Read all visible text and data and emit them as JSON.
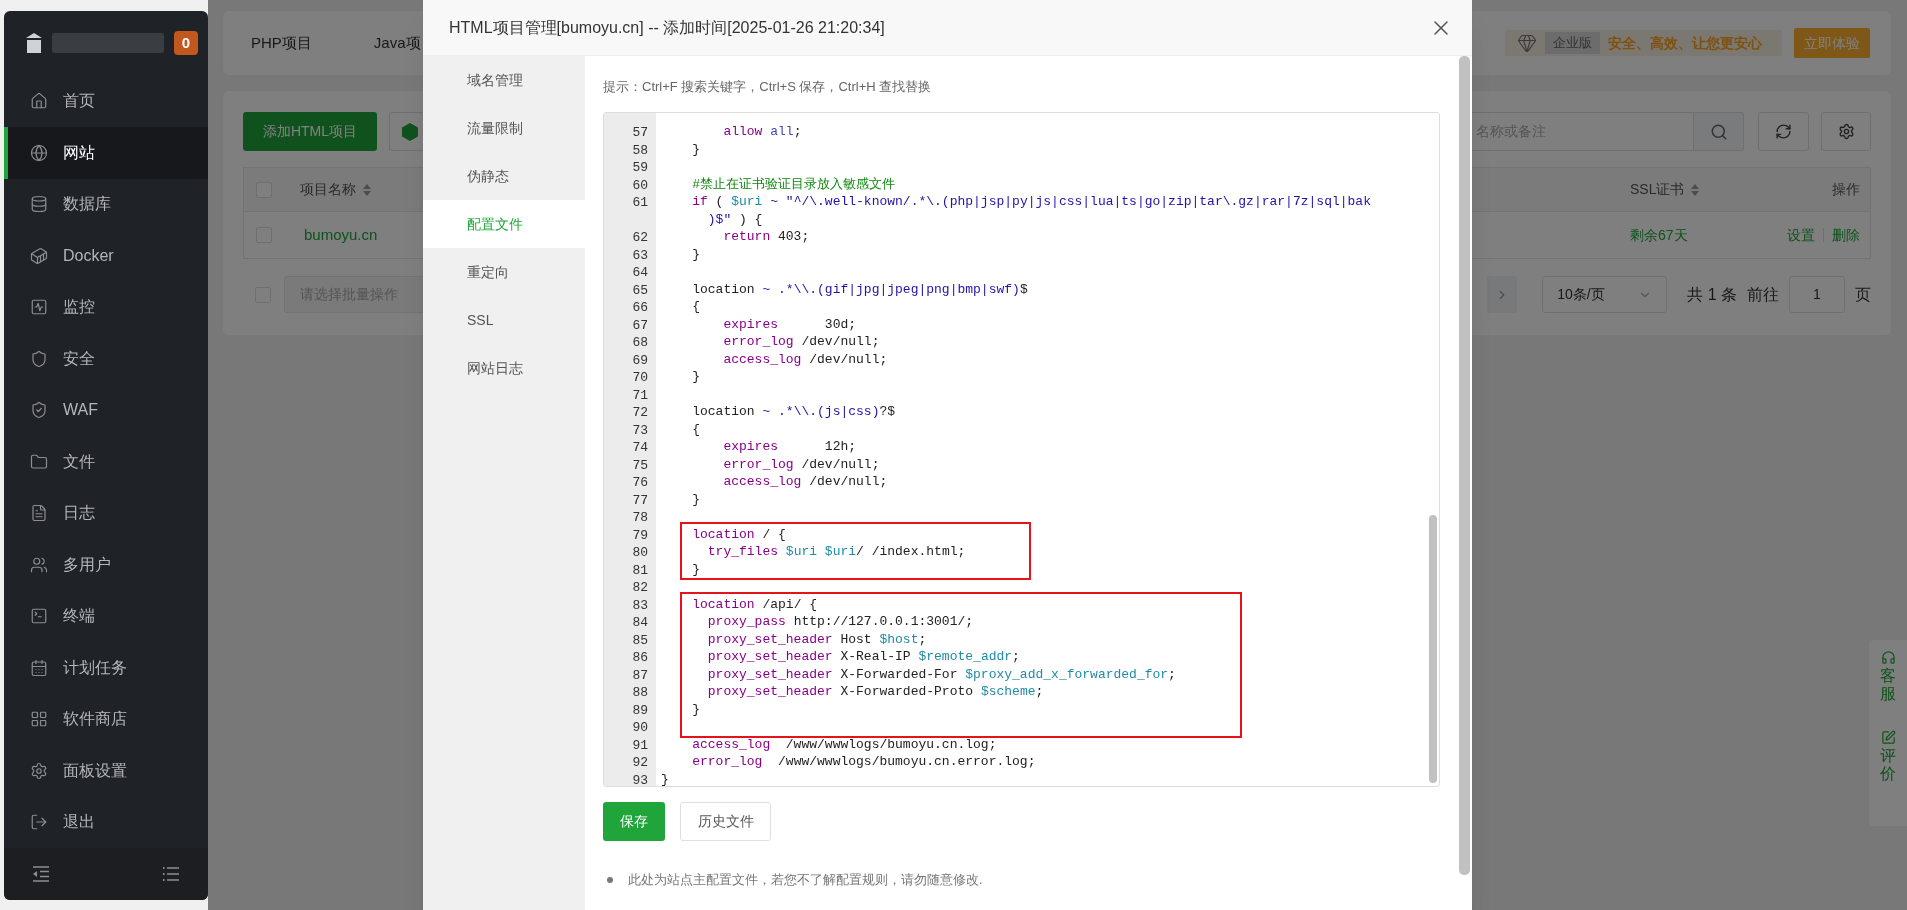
{
  "sidebar": {
    "badge": "0",
    "items": [
      {
        "label": "首页",
        "selected": false
      },
      {
        "label": "网站",
        "selected": true
      },
      {
        "label": "数据库",
        "selected": false
      },
      {
        "label": "Docker",
        "selected": false
      },
      {
        "label": "监控",
        "selected": false
      },
      {
        "label": "安全",
        "selected": false
      },
      {
        "label": "WAF",
        "selected": false
      },
      {
        "label": "文件",
        "selected": false
      },
      {
        "label": "日志",
        "selected": false
      },
      {
        "label": "多用户",
        "selected": false
      },
      {
        "label": "终端",
        "selected": false
      },
      {
        "label": "计划任务",
        "selected": false
      },
      {
        "label": "软件商店",
        "selected": false
      },
      {
        "label": "面板设置",
        "selected": false
      },
      {
        "label": "退出",
        "selected": false
      }
    ]
  },
  "page": {
    "tabs": [
      "PHP项目",
      "Java项"
    ],
    "promo": {
      "edition": "企业版",
      "slogan": "安全、高效、让您更安心",
      "button": "立即体验"
    },
    "toolbar": {
      "add_button": "添加HTML项目",
      "search_placeholder": "名称或备注"
    },
    "table": {
      "header_checked": false,
      "columns": [
        "项目名称",
        "SSL证书",
        "操作"
      ],
      "rows": [
        {
          "checked": false,
          "name": "bumoyu.cn",
          "ssl": "剩余67天",
          "actions": [
            "设置",
            "删除"
          ]
        }
      ]
    },
    "footer": {
      "checked": false,
      "batch_placeholder": "请选择批量操作",
      "page_size": "10条/页",
      "total": "共 1 条",
      "goto": "前往",
      "page": "1",
      "page_suffix": "页"
    },
    "float_panel": [
      "客服",
      "评价"
    ]
  },
  "modal": {
    "title": "HTML项目管理[bumoyu.cn] -- 添加时间[2025-01-26 21:20:34]",
    "nav": [
      {
        "label": "域名管理",
        "selected": false
      },
      {
        "label": "流量限制",
        "selected": false
      },
      {
        "label": "伪静态",
        "selected": false
      },
      {
        "label": "配置文件",
        "selected": true
      },
      {
        "label": "重定向",
        "selected": false
      },
      {
        "label": "SSL",
        "selected": false
      },
      {
        "label": "网站日志",
        "selected": false
      }
    ],
    "hint": "提示：Ctrl+F 搜索关键字，Ctrl+S 保存，Ctrl+H 查找替换",
    "editor": {
      "lines": [
        {
          "number": "57",
          "boxed": false,
          "tokens": [
            {
              "text": "        allow",
              "kind": "keyword"
            },
            {
              "text": " all",
              "kind": "atom"
            },
            {
              "text": ";",
              "kind": "plain"
            }
          ]
        },
        {
          "number": "58",
          "boxed": false,
          "tokens": [
            {
              "text": "    }",
              "kind": "plain"
            }
          ]
        },
        {
          "number": "59",
          "boxed": false
        },
        {
          "number": "60",
          "boxed": false,
          "tokens": [
            {
              "text": "    #禁止在证书验证目录放入敏感文件",
              "kind": "comment"
            }
          ]
        },
        {
          "number": "61",
          "boxed": false,
          "tokens": [
            {
              "text": "    if",
              "kind": "keyword"
            },
            {
              "text": " ( ",
              "kind": "plain"
            },
            {
              "text": "$uri",
              "kind": "variable"
            },
            {
              "text": " ~ \"^/\\.well-known/.*\\.(php|jsp|py|js|css|lua|ts|go|zip|tar\\.gz|rar|7z|sql|bak",
              "kind": "string"
            }
          ],
          "wrapped": [
            {
              "text": "      )$\"",
              "kind": "string"
            },
            {
              "text": " ) {",
              "kind": "plain"
            }
          ]
        },
        {
          "number": "62",
          "boxed": false,
          "tokens": [
            {
              "text": "        return",
              "kind": "keyword"
            },
            {
              "text": " 403;",
              "kind": "plain"
            }
          ]
        },
        {
          "number": "63",
          "boxed": false,
          "tokens": [
            {
              "text": "    }",
              "kind": "plain"
            }
          ]
        },
        {
          "number": "64",
          "boxed": false
        },
        {
          "number": "65",
          "boxed": false,
          "tokens": [
            {
              "text": "    location ",
              "kind": "plain"
            },
            {
              "text": "~ .*\\\\.(gif|jpg|jpeg|png|bmp|swf)",
              "kind": "string"
            },
            {
              "text": "$",
              "kind": "plain"
            }
          ]
        },
        {
          "number": "66",
          "boxed": false,
          "tokens": [
            {
              "text": "    {",
              "kind": "plain"
            }
          ]
        },
        {
          "number": "67",
          "boxed": false,
          "tokens": [
            {
              "text": "        expires",
              "kind": "keyword"
            },
            {
              "text": "      30d;",
              "kind": "plain"
            }
          ]
        },
        {
          "number": "68",
          "boxed": false,
          "tokens": [
            {
              "text": "        error_log",
              "kind": "keyword"
            },
            {
              "text": " /dev/null;",
              "kind": "plain"
            }
          ]
        },
        {
          "number": "69",
          "boxed": false,
          "tokens": [
            {
              "text": "        access_log",
              "kind": "keyword"
            },
            {
              "text": " /dev/null;",
              "kind": "plain"
            }
          ]
        },
        {
          "number": "70",
          "boxed": false,
          "tokens": [
            {
              "text": "    }",
              "kind": "plain"
            }
          ]
        },
        {
          "number": "71",
          "boxed": false
        },
        {
          "number": "72",
          "boxed": false,
          "tokens": [
            {
              "text": "    location ",
              "kind": "plain"
            },
            {
              "text": "~ .*\\\\.(js|css)",
              "kind": "string"
            },
            {
              "text": "?$",
              "kind": "plain"
            }
          ]
        },
        {
          "number": "73",
          "boxed": false,
          "tokens": [
            {
              "text": "    {",
              "kind": "plain"
            }
          ]
        },
        {
          "number": "74",
          "boxed": false,
          "tokens": [
            {
              "text": "        expires",
              "kind": "keyword"
            },
            {
              "text": "      12h;",
              "kind": "plain"
            }
          ]
        },
        {
          "number": "75",
          "boxed": false,
          "tokens": [
            {
              "text": "        error_log",
              "kind": "keyword"
            },
            {
              "text": " /dev/null;",
              "kind": "plain"
            }
          ]
        },
        {
          "number": "76",
          "boxed": false,
          "tokens": [
            {
              "text": "        access_log",
              "kind": "keyword"
            },
            {
              "text": " /dev/null;",
              "kind": "plain"
            }
          ]
        },
        {
          "number": "77",
          "boxed": false,
          "tokens": [
            {
              "text": "    }",
              "kind": "plain"
            }
          ]
        },
        {
          "number": "78",
          "boxed": false
        },
        {
          "number": "79",
          "boxed": true,
          "tokens": [
            {
              "text": "    location",
              "kind": "keyword"
            },
            {
              "text": " / {",
              "kind": "plain"
            }
          ]
        },
        {
          "number": "80",
          "boxed": true,
          "tokens": [
            {
              "text": "      try_files",
              "kind": "keyword"
            },
            {
              "text": " $uri",
              "kind": "variable"
            },
            {
              "text": " $uri",
              "kind": "variable"
            },
            {
              "text": "/ /index.html;",
              "kind": "plain"
            }
          ]
        },
        {
          "number": "81",
          "boxed": true,
          "tokens": [
            {
              "text": "    }",
              "kind": "plain"
            }
          ]
        },
        {
          "number": "82",
          "boxed": false
        },
        {
          "number": "83",
          "boxed": true,
          "tokens": [
            {
              "text": "    location",
              "kind": "keyword"
            },
            {
              "text": " /api/ {",
              "kind": "plain"
            }
          ]
        },
        {
          "number": "84",
          "boxed": true,
          "tokens": [
            {
              "text": "      proxy_pass",
              "kind": "keyword"
            },
            {
              "text": " http://127.0.0.1:3001/;",
              "kind": "plain"
            }
          ]
        },
        {
          "number": "85",
          "boxed": true,
          "tokens": [
            {
              "text": "      proxy_set_header",
              "kind": "keyword"
            },
            {
              "text": " Host ",
              "kind": "plain"
            },
            {
              "text": "$host",
              "kind": "variable"
            },
            {
              "text": ";",
              "kind": "plain"
            }
          ]
        },
        {
          "number": "86",
          "boxed": true,
          "tokens": [
            {
              "text": "      proxy_set_header",
              "kind": "keyword"
            },
            {
              "text": " X-Real-IP ",
              "kind": "plain"
            },
            {
              "text": "$remote_addr",
              "kind": "variable"
            },
            {
              "text": ";",
              "kind": "plain"
            }
          ]
        },
        {
          "number": "87",
          "boxed": true,
          "tokens": [
            {
              "text": "      proxy_set_header",
              "kind": "keyword"
            },
            {
              "text": " X-Forwarded-For ",
              "kind": "plain"
            },
            {
              "text": "$proxy_add_x_forwarded_for",
              "kind": "variable"
            },
            {
              "text": ";",
              "kind": "plain"
            }
          ]
        },
        {
          "number": "88",
          "boxed": true,
          "tokens": [
            {
              "text": "      proxy_set_header",
              "kind": "keyword"
            },
            {
              "text": " X-Forwarded-Proto ",
              "kind": "plain"
            },
            {
              "text": "$scheme",
              "kind": "variable"
            },
            {
              "text": ";",
              "kind": "plain"
            }
          ]
        },
        {
          "number": "89",
          "boxed": true,
          "tokens": [
            {
              "text": "    }",
              "kind": "plain"
            }
          ]
        },
        {
          "number": "90",
          "boxed": true
        },
        {
          "number": "91",
          "boxed": false,
          "tokens": [
            {
              "text": "    access_log",
              "kind": "keyword"
            },
            {
              "text": "  /www/wwwlogs/bumoyu.cn.log;",
              "kind": "plain"
            }
          ]
        },
        {
          "number": "92",
          "boxed": false,
          "tokens": [
            {
              "text": "    error_log",
              "kind": "keyword"
            },
            {
              "text": "  /www/wwwlogs/bumoyu.cn.error.log;",
              "kind": "plain"
            }
          ]
        },
        {
          "number": "93",
          "boxed": false,
          "tokens": [
            {
              "text": "}",
              "kind": "plain"
            }
          ]
        }
      ]
    },
    "buttons": [
      {
        "label": "保存",
        "kind": "primary"
      },
      {
        "label": "历史文件",
        "kind": "default"
      }
    ],
    "notes": [
      "此处为站点主配置文件，若您不了解配置规则，请勿随意修改."
    ]
  }
}
